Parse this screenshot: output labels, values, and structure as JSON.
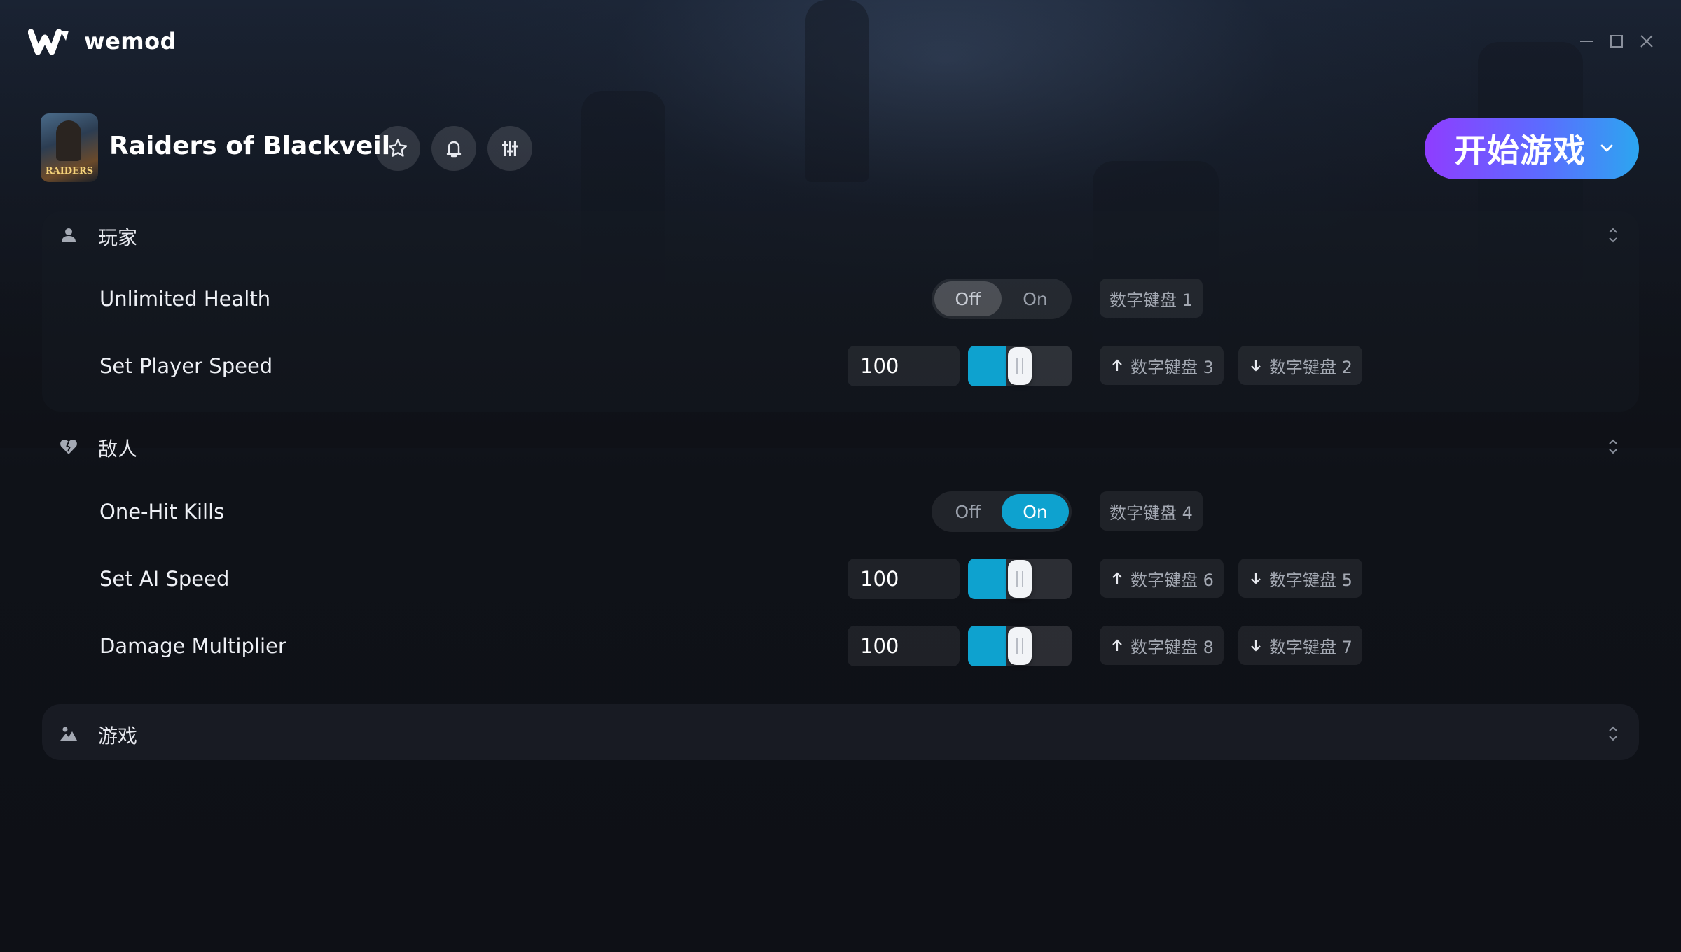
{
  "app": {
    "brand": "wemod"
  },
  "game": {
    "title": "Raiders of Blackveil",
    "cover_text": "RAIDERS"
  },
  "play": {
    "label": "开始游戏"
  },
  "colors": {
    "accent": "#0ea2cf",
    "play_gradient_start": "#8f3dff",
    "play_gradient_end": "#2ca6f0"
  },
  "sections": {
    "player": {
      "title": "玩家",
      "icon": "person-icon",
      "rows": {
        "health": {
          "label": "Unlimited Health",
          "off": "Off",
          "on": "On",
          "state": "off",
          "hotkey": "数字键盘 1"
        },
        "speed": {
          "label": "Set Player Speed",
          "value": "100",
          "level": 0.37,
          "hotkey_up": "数字键盘 3",
          "hotkey_down": "数字键盘 2"
        }
      }
    },
    "enemy": {
      "title": "敌人",
      "icon": "broken-heart-icon",
      "rows": {
        "kills": {
          "label": "One-Hit Kills",
          "off": "Off",
          "on": "On",
          "state": "on",
          "hotkey": "数字键盘 4"
        },
        "ai_speed": {
          "label": "Set AI Speed",
          "value": "100",
          "level": 0.37,
          "hotkey_up": "数字键盘 6",
          "hotkey_down": "数字键盘 5"
        },
        "damage": {
          "label": "Damage Multiplier",
          "value": "100",
          "level": 0.37,
          "hotkey_up": "数字键盘 8",
          "hotkey_down": "数字键盘 7"
        }
      }
    },
    "game": {
      "title": "游戏",
      "icon": "landscape-icon"
    }
  }
}
